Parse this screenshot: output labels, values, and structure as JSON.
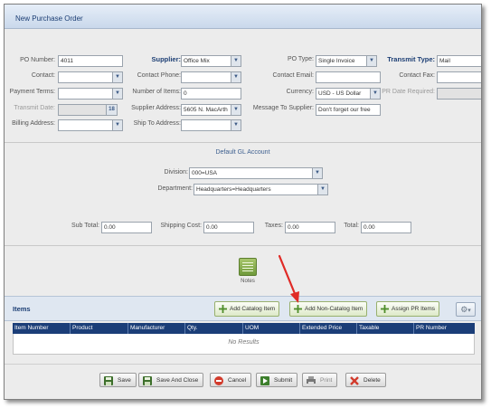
{
  "window": {
    "title": "New Purchase Order"
  },
  "form": {
    "po_number": {
      "label": "PO Number:",
      "value": "4011"
    },
    "supplier": {
      "label": "Supplier:",
      "value": "Office Mix"
    },
    "po_type": {
      "label": "PO Type:",
      "value": "Single Invoice"
    },
    "transmit_type": {
      "label": "Transmit Type:",
      "value": "Mail"
    },
    "contact": {
      "label": "Contact:",
      "value": ""
    },
    "contact_phone": {
      "label": "Contact Phone:",
      "value": ""
    },
    "contact_email": {
      "label": "Contact Email:",
      "value": ""
    },
    "contact_fax": {
      "label": "Contact Fax:",
      "value": ""
    },
    "payment_terms": {
      "label": "Payment Terms:",
      "value": ""
    },
    "number_of_items": {
      "label": "Number of Items:",
      "value": "0"
    },
    "currency": {
      "label": "Currency:",
      "value": "USD - US Dollar"
    },
    "pr_date_required": {
      "label": "PR Date Required:",
      "value": ""
    },
    "transmit_date": {
      "label": "Transmit Date:",
      "value": "",
      "calendar_glyph": "18"
    },
    "supplier_address": {
      "label": "Supplier Address:",
      "value": "5605 N. MacArth"
    },
    "message_to_supplier": {
      "label": "Message To Supplier:",
      "value": "Don't forget our free"
    },
    "billing_address": {
      "label": "Billing Address:",
      "value": ""
    },
    "ship_to_address": {
      "label": "Ship To Address:",
      "value": ""
    }
  },
  "gl": {
    "title": "Default GL Account",
    "division": {
      "label": "Division:",
      "value": "000=USA"
    },
    "department": {
      "label": "Department:",
      "value": "Headquarters=Headquarters"
    }
  },
  "totals": {
    "sub_total": {
      "label": "Sub Total:",
      "value": "0.00"
    },
    "shipping_cost": {
      "label": "Shipping Cost:",
      "value": "0.00"
    },
    "taxes": {
      "label": "Taxes:",
      "value": "0.00"
    },
    "total": {
      "label": "Total:",
      "value": "0.00"
    }
  },
  "notes": {
    "label": "Notes"
  },
  "items": {
    "title": "Items",
    "buttons": {
      "add_catalog": "Add Catalog Item",
      "add_non_catalog": "Add Non-Catalog Item",
      "assign_pr": "Assign PR Items"
    },
    "columns": [
      "Item Number",
      "Product",
      "Manufacturer",
      "Qty.",
      "UOM",
      "Extended Price",
      "Taxable",
      "PR Number"
    ],
    "empty_text": "No Results"
  },
  "footer": {
    "save": "Save",
    "save_close": "Save And Close",
    "cancel": "Cancel",
    "submit": "Submit",
    "print": "Print",
    "delete": "Delete"
  },
  "icons": {
    "dropdown": "▼",
    "gear": "⚙",
    "gear_caret": "▾"
  },
  "colors": {
    "accent": "#1c3e74",
    "grid_header": "#1b3e78",
    "arrow": "#e02a26",
    "add_button_border": "#98b06e"
  }
}
